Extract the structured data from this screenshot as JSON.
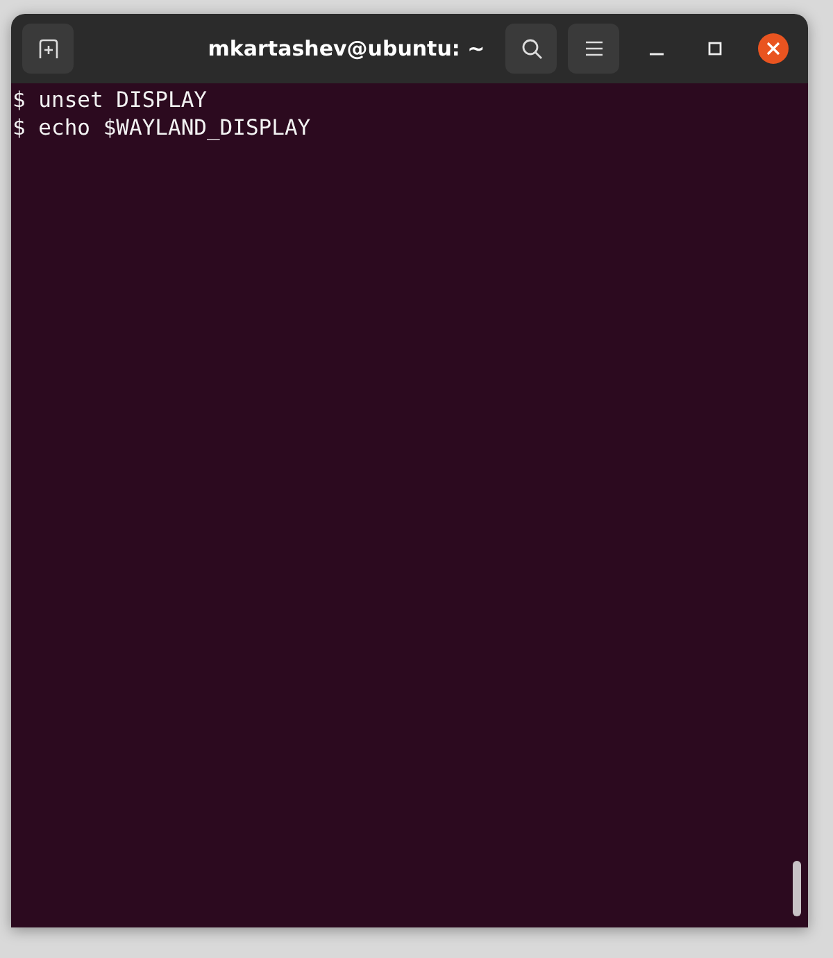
{
  "window": {
    "title": "mkartashev@ubuntu: ~"
  },
  "terminal": {
    "lines": [
      {
        "text": "$ unset DISPLAY"
      },
      {
        "text": "$ echo $WAYLAND_DISPLAY"
      }
    ]
  }
}
